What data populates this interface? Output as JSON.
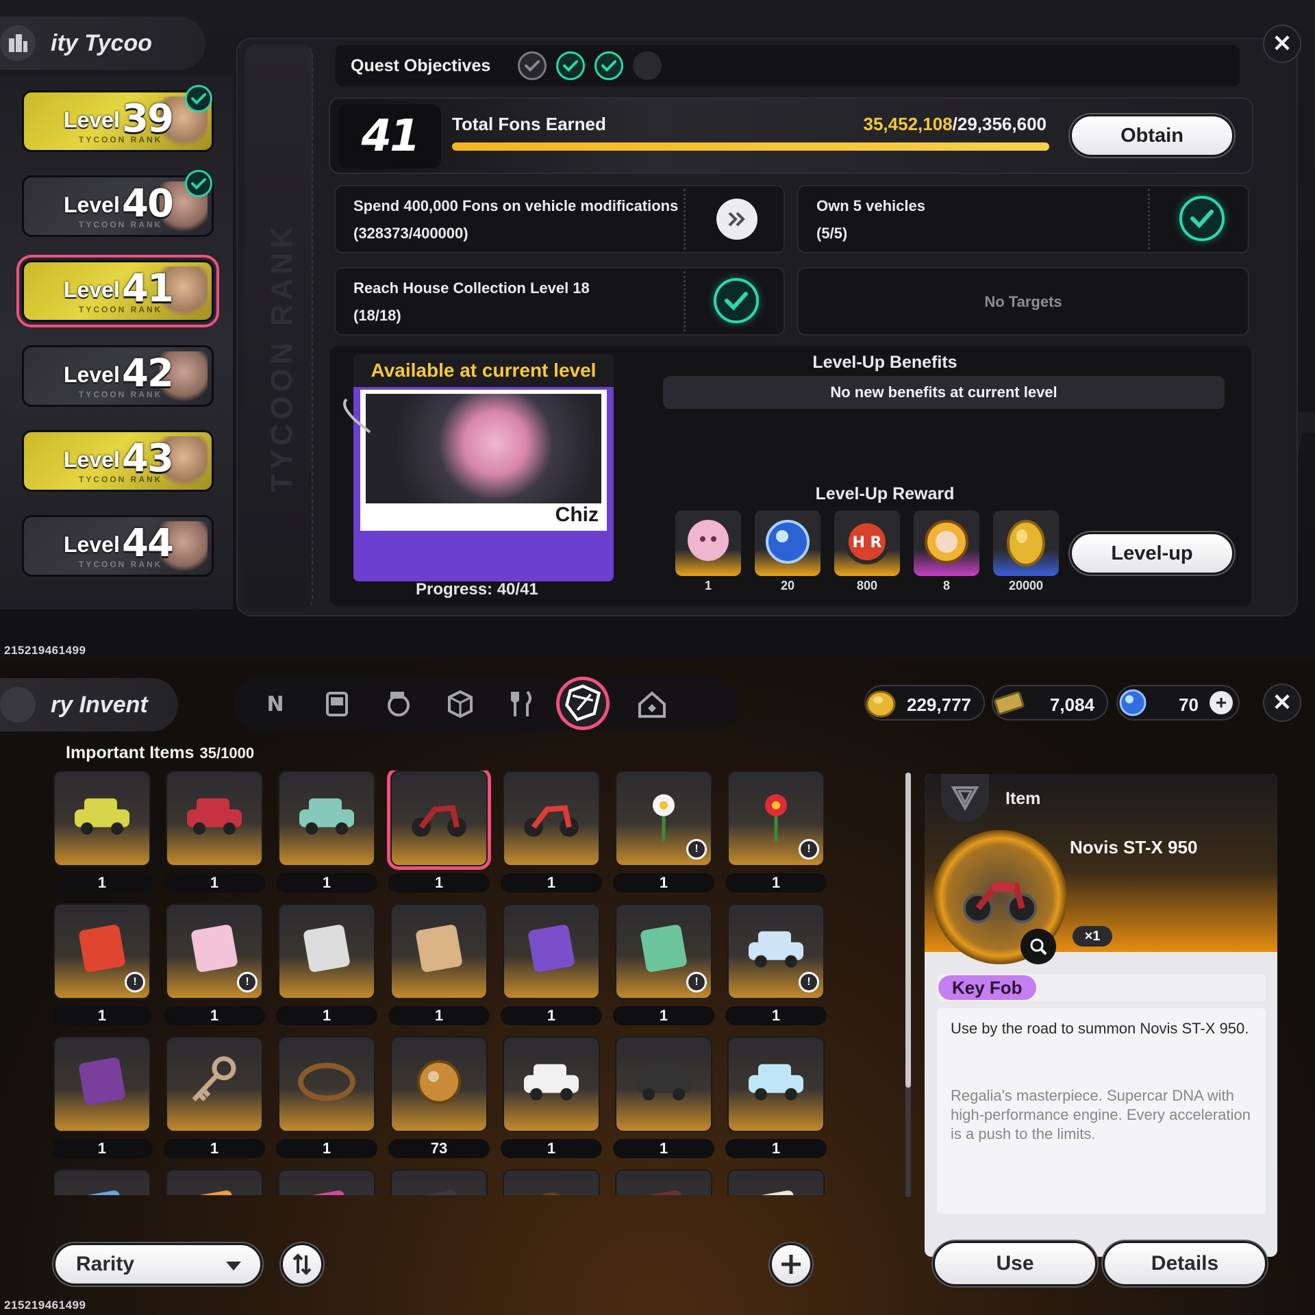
{
  "top": {
    "app_title": "ity Tycoo",
    "watermark": "TYCOON RANK",
    "levels": [
      {
        "label": "Level",
        "number": "39",
        "rank": "TYCOON RANK",
        "style": "gold",
        "completed": true,
        "selected": false
      },
      {
        "label": "Level",
        "number": "40",
        "rank": "TYCOON RANK",
        "style": "dark",
        "completed": true,
        "selected": false
      },
      {
        "label": "Level",
        "number": "41",
        "rank": "TYCOON RANK",
        "style": "gold",
        "completed": false,
        "selected": true
      },
      {
        "label": "Level",
        "number": "42",
        "rank": "TYCOON RANK",
        "style": "dark",
        "completed": false,
        "selected": false
      },
      {
        "label": "Level",
        "number": "43",
        "rank": "TYCOON RANK",
        "style": "gold",
        "completed": false,
        "selected": false
      },
      {
        "label": "Level",
        "number": "44",
        "rank": "TYCOON RANK",
        "style": "dark",
        "completed": false,
        "selected": false
      }
    ],
    "quest_objectives": {
      "label": "Quest Objectives",
      "indicators": [
        "gray",
        "green",
        "green",
        "empty"
      ]
    },
    "total_fons": {
      "level": "41",
      "title": "Total Fons Earned",
      "current": "35,452,108",
      "goal": "/29,356,600",
      "progress": 1.0,
      "obtain_label": "Obtain"
    },
    "objectives": [
      {
        "line1": "Spend 400,000 Fons on vehicle modifications",
        "line2": "(328373/400000)",
        "status": "go"
      },
      {
        "line1": "Own 5 vehicles",
        "line2": "(5/5)",
        "status": "done"
      },
      {
        "line1": "Reach House Collection Level 18",
        "line2": "(18/18)",
        "status": "done"
      },
      {
        "line1": "No Targets",
        "line2": "",
        "status": "none"
      }
    ],
    "available": {
      "header": "Available at current level",
      "character_name": "Chiz",
      "progress_label": "Progress: 40/41"
    },
    "benefits": {
      "title": "Level-Up Benefits",
      "text": "No new benefits at current level"
    },
    "reward": {
      "title": "Level-Up Reward",
      "items": [
        {
          "icon": "character-portrait-icon",
          "qty": "1",
          "bg": "#e9a21a"
        },
        {
          "icon": "blue-orb-icon",
          "qty": "20",
          "bg": "#e9a21a"
        },
        {
          "icon": "hunter-badge-icon",
          "qty": "800",
          "bg": "#e9a21a"
        },
        {
          "icon": "mascot-coin-icon",
          "qty": "8",
          "bg": "#c63fc4"
        },
        {
          "icon": "gold-coin-icon",
          "qty": "20000",
          "bg": "#3b5fd9"
        }
      ],
      "levelup_label": "Level-up"
    },
    "close_label": "✕",
    "uid": "215219461499"
  },
  "bottom": {
    "app_title": "ry   Invent",
    "tabs": [
      {
        "icon": "logo-tab-icon",
        "active": false
      },
      {
        "icon": "gamepad-tab-icon",
        "active": false
      },
      {
        "icon": "disc-tab-icon",
        "active": false
      },
      {
        "icon": "box-tab-icon",
        "active": false
      },
      {
        "icon": "food-tab-icon",
        "active": false
      },
      {
        "icon": "important-items-tab-icon",
        "active": true
      },
      {
        "icon": "house-tab-icon",
        "active": false
      }
    ],
    "currencies": [
      {
        "icon": "gold-coin-icon",
        "value": "229,777"
      },
      {
        "icon": "ticket-icon",
        "value": "7,084"
      },
      {
        "icon": "blue-orb-icon",
        "value": "70"
      }
    ],
    "section": {
      "title": "Important Items",
      "count": "35/1000"
    },
    "items": [
      {
        "icon": "yellow-suv-icon",
        "qty": "1",
        "info": false,
        "selected": false
      },
      {
        "icon": "red-sedan-icon",
        "qty": "1",
        "info": false,
        "selected": false
      },
      {
        "icon": "teal-car-icon",
        "qty": "1",
        "info": false,
        "selected": false
      },
      {
        "icon": "motorcycle-icon",
        "qty": "1",
        "info": false,
        "selected": true
      },
      {
        "icon": "red-scooter-icon",
        "qty": "1",
        "info": false,
        "selected": false
      },
      {
        "icon": "daisy-flower-icon",
        "qty": "1",
        "info": true,
        "selected": false
      },
      {
        "icon": "red-rose-icon",
        "qty": "1",
        "info": true,
        "selected": false
      },
      {
        "icon": "juice-pouch-icon",
        "qty": "1",
        "info": true,
        "selected": false
      },
      {
        "icon": "ice-cream-cones-icon",
        "qty": "1",
        "info": true,
        "selected": false
      },
      {
        "icon": "photos-icon",
        "qty": "1",
        "info": false,
        "selected": false
      },
      {
        "icon": "notebook-icon",
        "qty": "1",
        "info": false,
        "selected": false
      },
      {
        "icon": "test-tube-icon",
        "qty": "1",
        "info": false,
        "selected": false
      },
      {
        "icon": "star-hairclip-icon",
        "qty": "1",
        "info": true,
        "selected": false
      },
      {
        "icon": "id-card-icon",
        "qty": "1",
        "info": true,
        "selected": false
      },
      {
        "icon": "character-figure-icon",
        "qty": "1",
        "info": false,
        "selected": false
      },
      {
        "icon": "key-icon",
        "qty": "1",
        "info": false,
        "selected": false
      },
      {
        "icon": "wreath-icon",
        "qty": "1",
        "info": false,
        "selected": false
      },
      {
        "icon": "bronze-coin-icon",
        "qty": "73",
        "info": false,
        "selected": false
      },
      {
        "icon": "pointing-hand-card-icon",
        "qty": "1",
        "info": false,
        "selected": false
      },
      {
        "icon": "sunglasses-card-icon",
        "qty": "1",
        "info": false,
        "selected": false
      },
      {
        "icon": "cosmetics-card-icon",
        "qty": "1",
        "info": false,
        "selected": false
      },
      {
        "icon": "blue-photo-icon",
        "qty": "",
        "info": false,
        "selected": false
      },
      {
        "icon": "orange-photo-icon",
        "qty": "",
        "info": false,
        "selected": false
      },
      {
        "icon": "pink-device-icon",
        "qty": "",
        "info": false,
        "selected": false
      },
      {
        "icon": "dark-plush-icon",
        "qty": "",
        "info": false,
        "selected": false
      },
      {
        "icon": "purple-orb-icon",
        "qty": "",
        "info": false,
        "selected": false
      },
      {
        "icon": "glasses-icon",
        "qty": "",
        "info": false,
        "selected": false
      },
      {
        "icon": "bun-icon",
        "qty": "",
        "info": false,
        "selected": false
      }
    ],
    "rarity_label": "Rarity",
    "detail": {
      "tag_label": "Item",
      "name": "Novis ST-X 950",
      "count": "×1",
      "type": "Key Fob",
      "description": "Use by the road to summon Novis ST-X 950.",
      "flavor": "Regalia's masterpiece. Supercar DNA with high-performance engine. Every acceleration is a push to the limits.",
      "use_label": "Use",
      "details_label": "Details"
    },
    "close_label": "✕",
    "uid": "215219461499"
  }
}
